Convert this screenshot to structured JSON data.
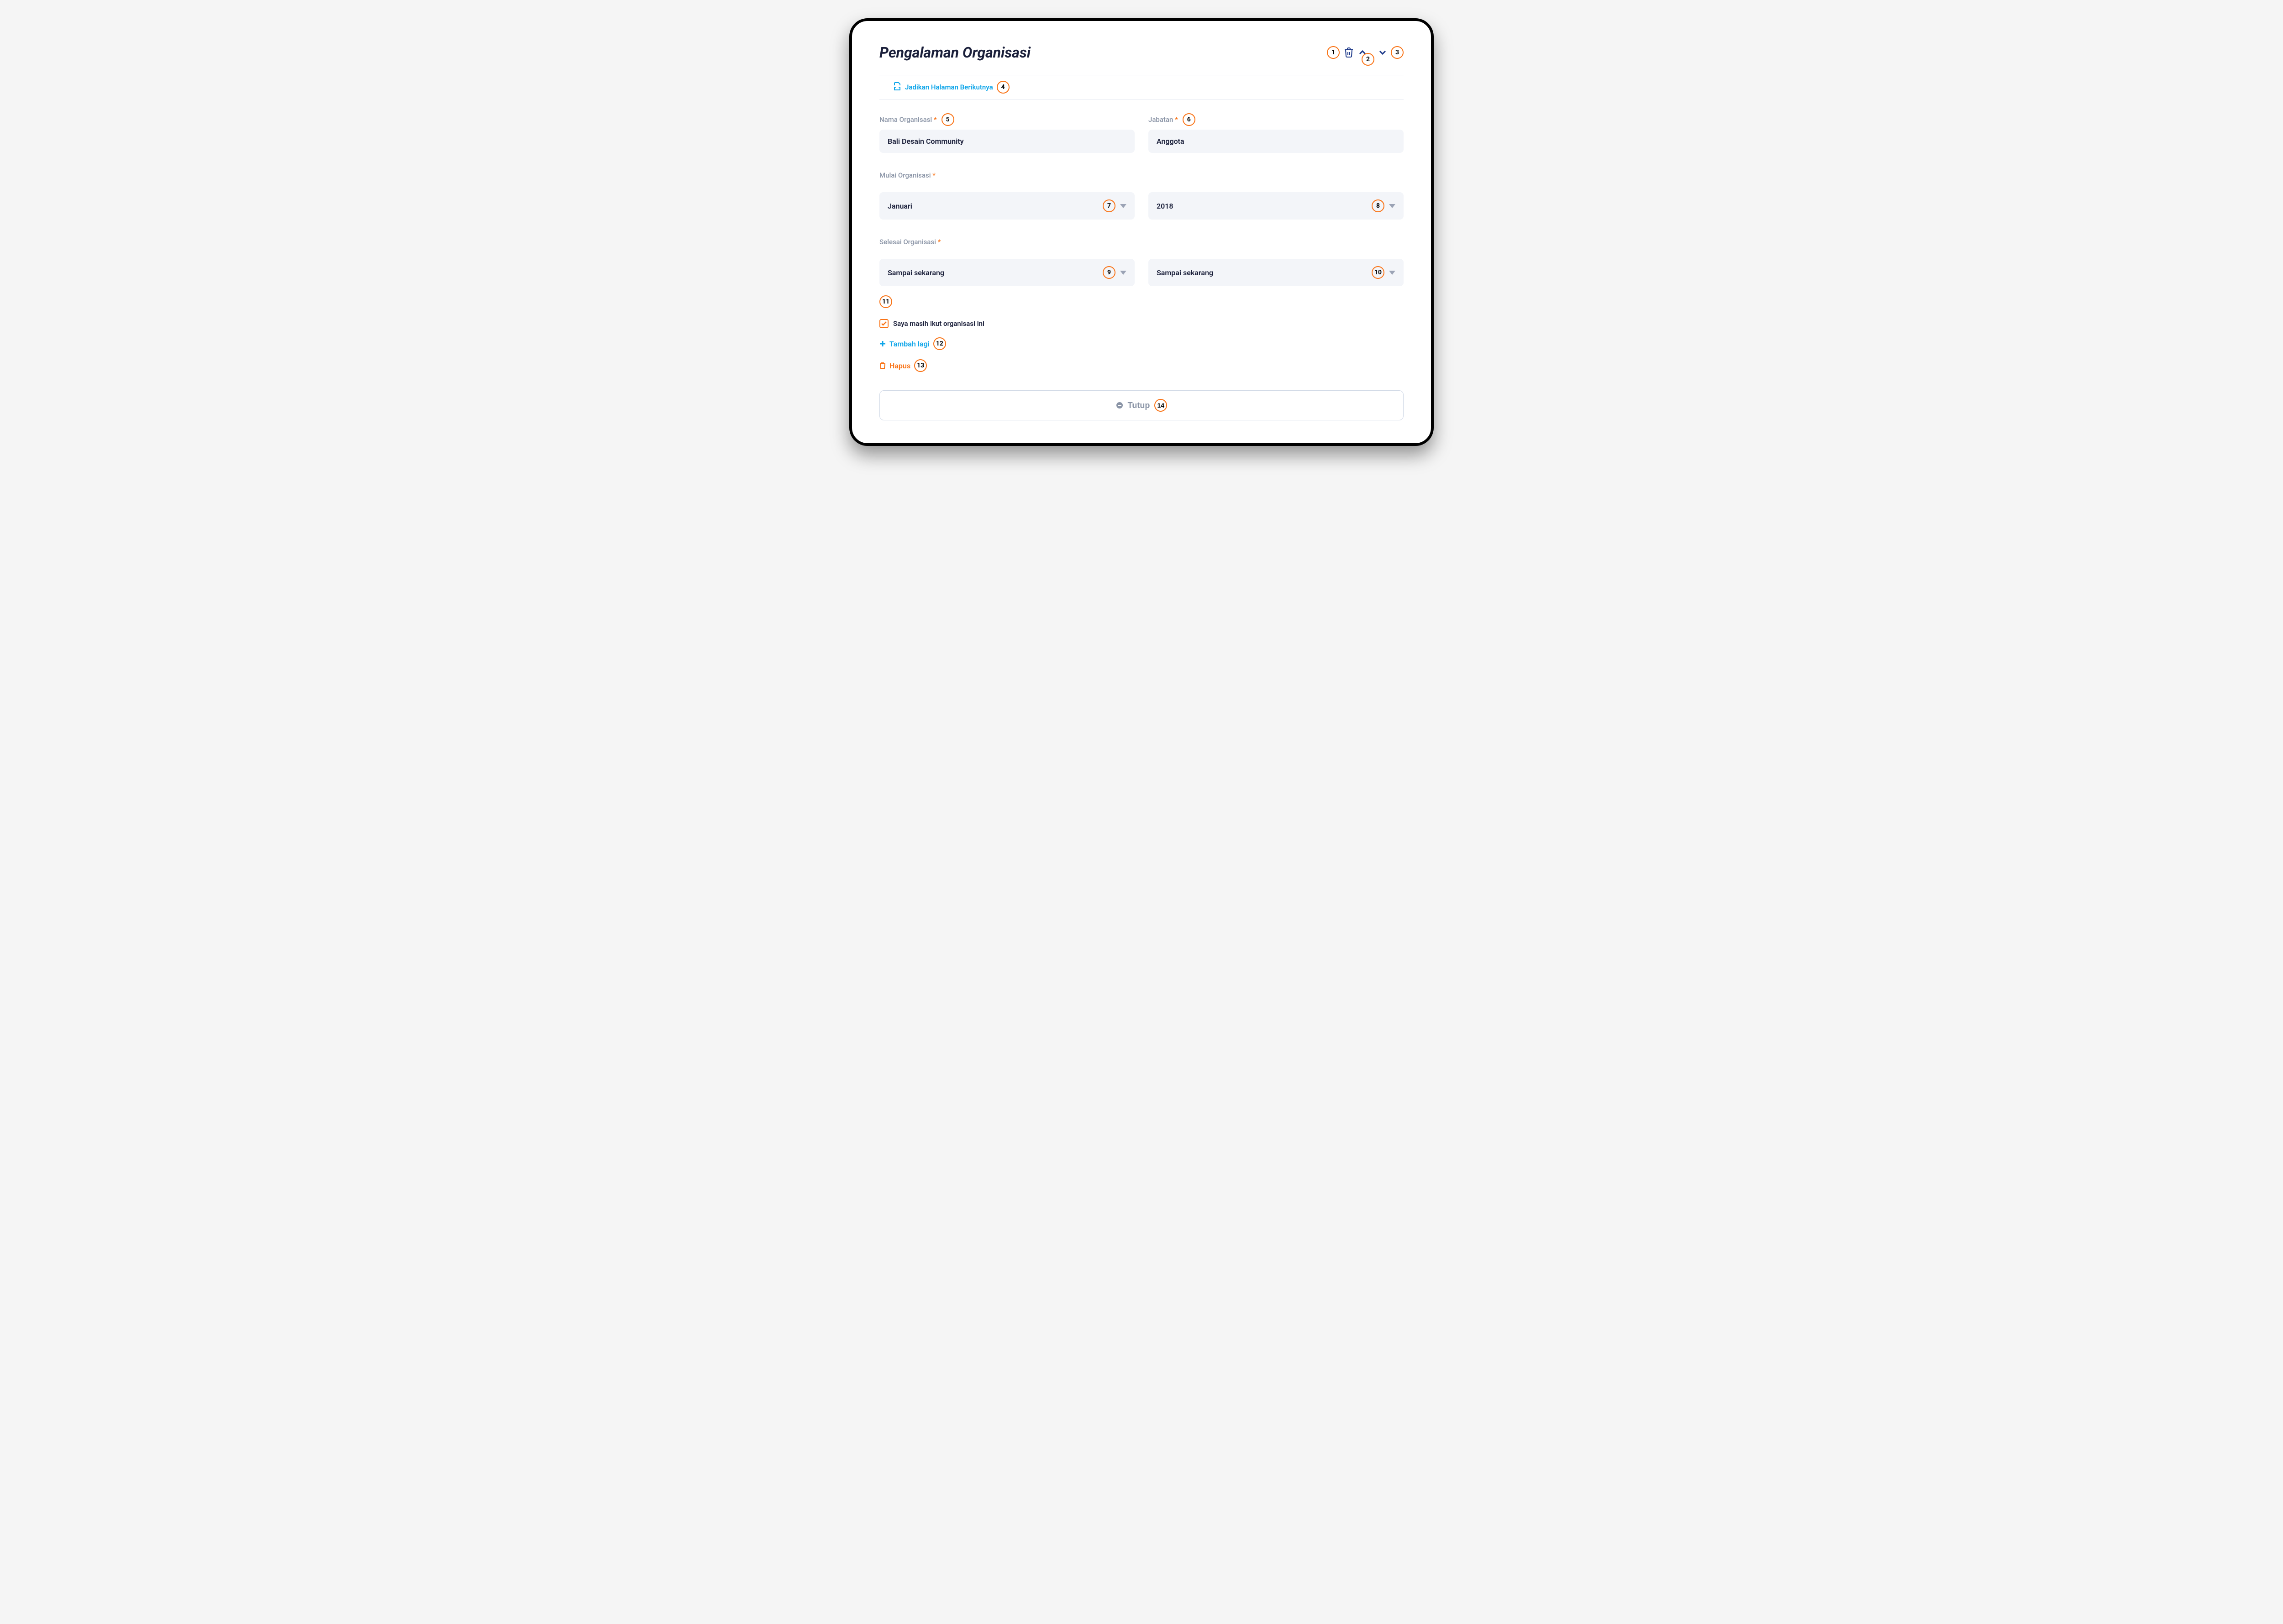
{
  "title": "Pengalaman Organisasi",
  "badges": {
    "b1": "1",
    "b2": "2",
    "b3": "3",
    "b4": "4",
    "b5": "5",
    "b6": "6",
    "b7": "7",
    "b8": "8",
    "b9": "9",
    "b10": "10",
    "b11": "11",
    "b12": "12",
    "b13": "13",
    "b14": "14"
  },
  "next_page_label": "Jadikan Halaman Berikutnya",
  "fields": {
    "nama_organisasi": {
      "label": "Nama Organisasi",
      "value": "Bali Desain Community"
    },
    "jabatan": {
      "label": "Jabatan",
      "value": "Anggota"
    },
    "mulai_organisasi_label": "Mulai Organisasi",
    "mulai_bulan": "Januari",
    "mulai_tahun": "2018",
    "selesai_organisasi_label": "Selesai Organisasi",
    "selesai_bulan": "Sampai sekarang",
    "selesai_tahun": "Sampai sekarang"
  },
  "checkbox_label": "Saya masih ikut organisasi ini",
  "add_more_label": "Tambah lagi",
  "delete_label": "Hapus",
  "close_label": "Tutup"
}
